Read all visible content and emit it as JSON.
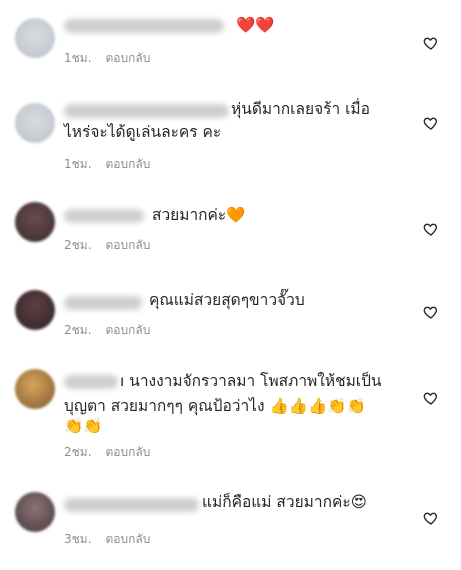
{
  "comments": [
    {
      "text": "",
      "emoji": "❤️❤️",
      "time": "1ชม.",
      "reply": "ตอบกลับ"
    },
    {
      "text_line1": "หุ่นดีมากเลยจร้า เมื่อ",
      "text_line2": "ไหร่จะได้ดูเล่นละคร คะ",
      "time": "1ชม.",
      "reply": "ตอบกลับ"
    },
    {
      "text": "สวยมากค่ะ🧡",
      "time": "2ชม.",
      "reply": "ตอบกลับ"
    },
    {
      "text": "คุณแม่สวยสุดๆขาวจั๊วบ",
      "time": "2ชม.",
      "reply": "ตอบกลับ"
    },
    {
      "text_line1": "ı นางงามจักรวาลมา  โพสภาพให้ชมเป็น",
      "text_line2": "บุญตา  สวยมากๆๆ คุณป้อว่าไง 👍👍👍👏👏",
      "text_line3": "👏👏",
      "time": "2ชม.",
      "reply": "ตอบกลับ"
    },
    {
      "text": "แม่ก็คือแม่ สวยมากค่ะ😍",
      "time": "3ชม.",
      "reply": "ตอบกลับ"
    }
  ],
  "colors": {
    "text": "#262626",
    "meta": "#8e8e8e",
    "heart_outline": "#262626"
  },
  "icons": {
    "like": "heart-outline-icon"
  }
}
